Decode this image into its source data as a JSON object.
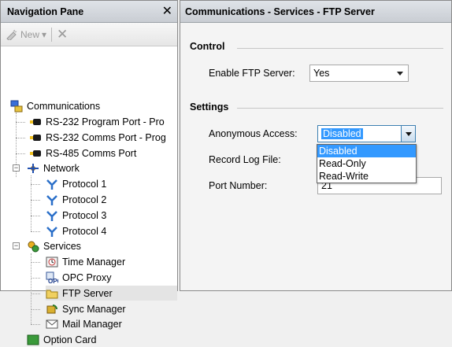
{
  "nav": {
    "title": "Navigation Pane",
    "toolbar": {
      "new_label": "New",
      "new_arrow": "▾"
    },
    "tree": {
      "communications": "Communications",
      "rs232_program": "RS-232 Program Port - Pro",
      "rs232_comms": "RS-232 Comms Port - Prog",
      "rs485_comms": "RS-485 Comms Port",
      "network": "Network",
      "protocol1": "Protocol 1",
      "protocol2": "Protocol 2",
      "protocol3": "Protocol 3",
      "protocol4": "Protocol 4",
      "services": "Services",
      "time_manager": "Time Manager",
      "opc_proxy": "OPC Proxy",
      "ftp_server": "FTP Server",
      "sync_manager": "Sync Manager",
      "mail_manager": "Mail Manager",
      "option_card_partial": "Option Card"
    },
    "expanders": {
      "network": "−",
      "services": "−"
    }
  },
  "main": {
    "title": "Communications - Services - FTP Server",
    "control": {
      "heading": "Control",
      "enable_ftp_label": "Enable FTP Server:",
      "enable_ftp_value": "Yes"
    },
    "settings": {
      "heading": "Settings",
      "anonymous_label": "Anonymous Access:",
      "anonymous_value": "Disabled",
      "anonymous_options": [
        "Disabled",
        "Read-Only",
        "Read-Write"
      ],
      "record_log_label": "Record Log File:",
      "port_label": "Port Number:",
      "port_value": "21"
    }
  },
  "colors": {
    "selection": "#3399ff",
    "header_bg": "#d4d8dd",
    "selected_row": "#e4e4e4"
  }
}
